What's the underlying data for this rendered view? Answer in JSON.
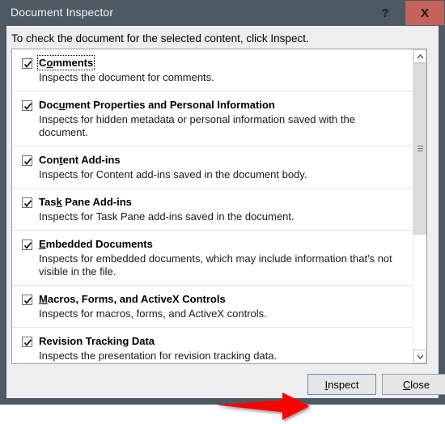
{
  "window": {
    "title": "Document Inspector",
    "help_label": "?",
    "close_label": "X",
    "colors": {
      "titlebar": "#4d5a63",
      "close_button": "#c4625c",
      "client": "#eeeeee",
      "focus_border": "#4a90d9",
      "annotation": "#ff0000"
    }
  },
  "instruction": "To check the document for the selected content, click Inspect.",
  "list": {
    "items": [
      {
        "label": "Comments",
        "label_pre": "C",
        "label_acc": "o",
        "label_post": "mments",
        "description": "Inspects the document for comments.",
        "checked": true,
        "focused": true
      },
      {
        "label": "Document Properties and Personal Information",
        "label_pre": "Doc",
        "label_acc": "u",
        "label_post": "ment Properties and Personal Information",
        "description": "Inspects for hidden metadata or personal information saved with the document.",
        "checked": true,
        "focused": false
      },
      {
        "label": "Content Add-ins",
        "label_pre": "Con",
        "label_acc": "t",
        "label_post": "ent Add-ins",
        "description": "Inspects for Content add-ins saved in the document body.",
        "checked": true,
        "focused": false
      },
      {
        "label": "Task Pane Add-ins",
        "label_pre": "Tas",
        "label_acc": "k",
        "label_post": " Pane Add-ins",
        "description": "Inspects for Task Pane add-ins saved in the document.",
        "checked": true,
        "focused": false
      },
      {
        "label": "Embedded Documents",
        "label_pre": "",
        "label_acc": "E",
        "label_post": "mbedded Documents",
        "description": "Inspects for embedded documents, which may include information that's not visible in the file.",
        "checked": true,
        "focused": false
      },
      {
        "label": "Macros, Forms, and ActiveX Controls",
        "label_pre": "",
        "label_acc": "M",
        "label_post": "acros, Forms, and ActiveX Controls",
        "description": "Inspects for macros, forms, and ActiveX controls.",
        "checked": true,
        "focused": false
      },
      {
        "label": "Revision Tracking Data",
        "label_pre": "Revision Tracking Data",
        "label_acc": "",
        "label_post": "",
        "description": "Inspects the presentation for revision tracking data.",
        "checked": true,
        "focused": false
      }
    ],
    "scrollbar": {
      "up_arrow": "chevron-up",
      "down_arrow": "chevron-down",
      "thumb_position_percent": 0
    }
  },
  "footer": {
    "inspect": {
      "pre": "",
      "acc": "I",
      "post": "nspect",
      "label": "Inspect"
    },
    "close": {
      "pre": "",
      "acc": "C",
      "post": "lose",
      "label": "Close"
    }
  },
  "annotation": {
    "type": "arrow",
    "direction": "right",
    "points_to": "Inspect"
  }
}
